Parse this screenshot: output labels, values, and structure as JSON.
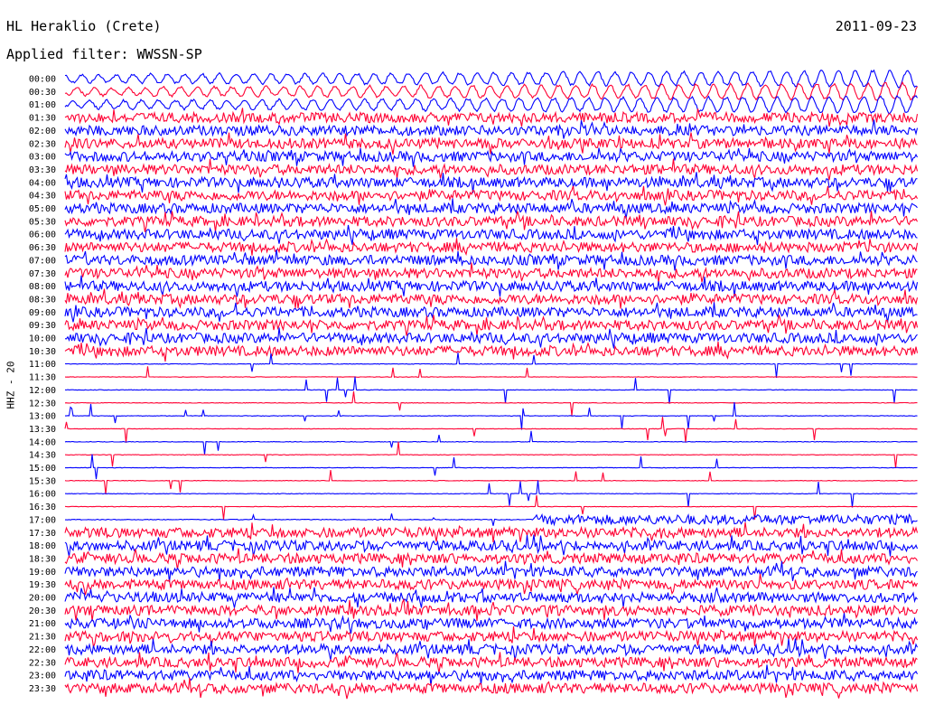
{
  "header": {
    "station": "HL Heraklio (Crete)",
    "date": "2011-09-23",
    "filter": "Applied filter: WWSSN-SP"
  },
  "chart_data": {
    "type": "line",
    "ylabel": "HHZ - 20",
    "time_labels": [
      "00:00",
      "00:30",
      "01:00",
      "01:30",
      "02:00",
      "02:30",
      "03:00",
      "03:30",
      "04:00",
      "04:30",
      "05:00",
      "05:30",
      "06:00",
      "06:30",
      "07:00",
      "07:30",
      "08:00",
      "08:30",
      "09:00",
      "09:30",
      "10:00",
      "10:30",
      "11:00",
      "11:30",
      "12:00",
      "12:30",
      "13:00",
      "13:30",
      "14:00",
      "14:30",
      "15:00",
      "15:30",
      "16:00",
      "16:30",
      "17:00",
      "17:30",
      "18:00",
      "18:30",
      "19:00",
      "19:30",
      "20:00",
      "20:30",
      "21:00",
      "21:30",
      "22:00",
      "22:30",
      "23:00",
      "23:30"
    ],
    "colors": [
      "#0000ff",
      "#ff0033"
    ],
    "activity": [
      "swell",
      "swell",
      "swell",
      "high",
      "high",
      "high",
      "high",
      "high",
      "high",
      "high",
      "high",
      "high",
      "high",
      "high",
      "high",
      "high",
      "high",
      "high",
      "high",
      "high",
      "high",
      "high",
      "quiet",
      "quiet",
      "quiet",
      "quiet",
      "quiet",
      "quiet",
      "quiet",
      "quiet",
      "quiet",
      "quiet",
      "quiet",
      "quiet",
      "mixed",
      "high",
      "high",
      "high",
      "high",
      "high",
      "high",
      "high",
      "high",
      "high",
      "high",
      "high",
      "high",
      "high"
    ]
  }
}
